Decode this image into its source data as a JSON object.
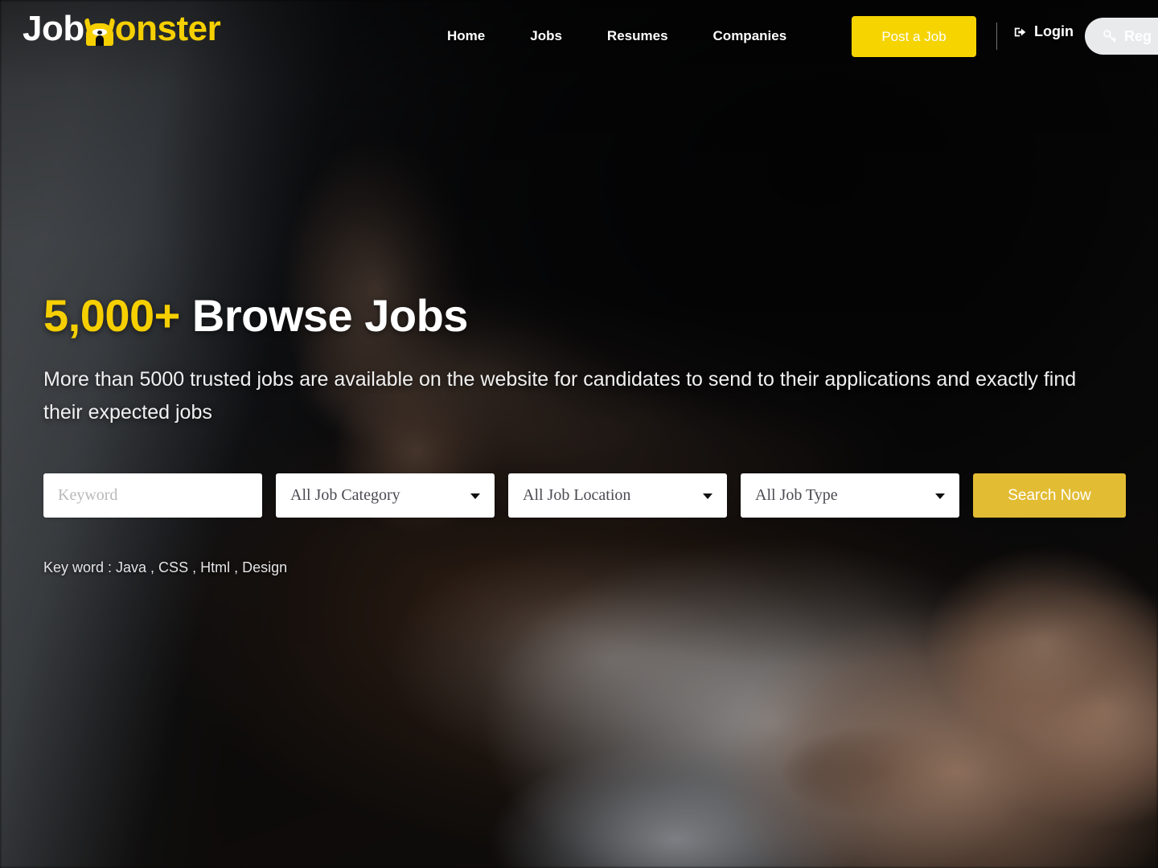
{
  "brand": {
    "name_part1": "Job",
    "name_part2": "onster",
    "icon": "monster-head-icon",
    "white": "#ffffff",
    "yellow": "#f5cf00"
  },
  "header": {
    "nav": [
      {
        "label": "Home"
      },
      {
        "label": "Jobs"
      },
      {
        "label": "Resumes"
      },
      {
        "label": "Companies"
      }
    ],
    "post_job_label": "Post a Job",
    "post_job_color": "#f5d400",
    "login_label": "Login",
    "login_icon": "sign-in-icon",
    "register_label": "Reg",
    "register_icon": "key-icon",
    "register_bg": "#e9eaec"
  },
  "hero": {
    "title_count": "5,000+",
    "title_rest": " Browse Jobs",
    "subtitle": "More than 5000 trusted jobs are available on the website for candidates to send to their applications and exactly find their expected jobs",
    "keyword_hint": "Key word : Java , CSS , Html , Design"
  },
  "search": {
    "keyword_placeholder": "Keyword",
    "keyword_value": "",
    "category_selected": "All Job Category",
    "location_selected": "All Job Location",
    "type_selected": "All Job Type",
    "submit_label": "Search Now",
    "submit_color": "#e2bc33"
  }
}
